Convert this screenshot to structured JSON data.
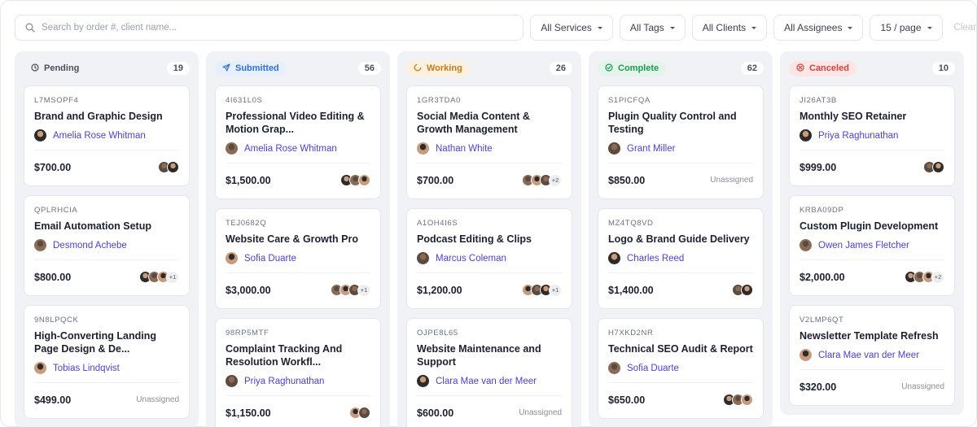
{
  "search": {
    "placeholder": "Search by order #, client name..."
  },
  "filters": [
    {
      "label": "All Services"
    },
    {
      "label": "All Tags"
    },
    {
      "label": "All Clients"
    },
    {
      "label": "All Assignees"
    },
    {
      "label": "15 / page"
    }
  ],
  "clear_label": "Clear",
  "colors": {
    "avatar_a": "#5b4a3f",
    "avatar_b": "#2e2a28",
    "avatar_c": "#8a6b55",
    "avatar_d": "#c79b7d"
  },
  "columns": [
    {
      "status": "Pending",
      "icon": "clock-icon",
      "count": "19",
      "color": "#4a4f5b",
      "bg": "transparent",
      "cards": [
        {
          "code": "L7MSOPF4",
          "title": "Brand and Graphic Design",
          "client": "Amelia Rose Whitman",
          "price": "$700.00",
          "assignees": 2,
          "more": "",
          "unassigned": ""
        },
        {
          "code": "QPLRHCIA",
          "title": "Email Automation Setup",
          "client": "Desmond Achebe",
          "price": "$800.00",
          "assignees": 3,
          "more": "+1",
          "unassigned": ""
        },
        {
          "code": "9N8LPQCK",
          "title": "High-Converting Landing Page Design & De...",
          "client": "Tobias Lindqvist",
          "price": "$499.00",
          "assignees": 0,
          "more": "",
          "unassigned": "Unassigned"
        }
      ]
    },
    {
      "status": "Submitted",
      "icon": "send-icon",
      "count": "56",
      "color": "#2f6fd6",
      "bg": "#e6effc",
      "cards": [
        {
          "code": "4I631L0S",
          "title": "Professional Video Editing & Motion Grap...",
          "client": "Amelia Rose Whitman",
          "price": "$1,500.00",
          "assignees": 3,
          "more": "",
          "unassigned": ""
        },
        {
          "code": "TEJ0682Q",
          "title": "Website Care & Growth Pro",
          "client": "Sofia Duarte",
          "price": "$3,000.00",
          "assignees": 3,
          "more": "+1",
          "unassigned": ""
        },
        {
          "code": "98RP5MTF",
          "title": "Complaint Tracking And Resolution Workfl...",
          "client": "Priya Raghunathan",
          "price": "$1,150.00",
          "assignees": 2,
          "more": "",
          "unassigned": ""
        }
      ]
    },
    {
      "status": "Working",
      "icon": "spinner-icon",
      "count": "26",
      "color": "#c7791a",
      "bg": "#fdf0dc",
      "cards": [
        {
          "code": "1GR3TDA0",
          "title": "Social Media Content & Growth Management",
          "client": "Nathan White",
          "price": "$700.00",
          "assignees": 3,
          "more": "+2",
          "unassigned": ""
        },
        {
          "code": "A1OH4I6S",
          "title": "Podcast Editing & Clips",
          "client": "Marcus Coleman",
          "price": "$1,200.00",
          "assignees": 3,
          "more": "+1",
          "unassigned": ""
        },
        {
          "code": "OJPE8L65",
          "title": "Website Maintenance and Support",
          "client": "Clara Mae van der Meer",
          "price": "$600.00",
          "assignees": 0,
          "more": "",
          "unassigned": "Unassigned"
        }
      ]
    },
    {
      "status": "Complete",
      "icon": "check-circle-icon",
      "count": "62",
      "color": "#1f9a55",
      "bg": "#e3f5ea",
      "cards": [
        {
          "code": "S1PICFQA",
          "title": "Plugin Quality Control and Testing",
          "client": "Grant Miller",
          "price": "$850.00",
          "assignees": 0,
          "more": "",
          "unassigned": "Unassigned"
        },
        {
          "code": "MZ4TQ8VD",
          "title": "Logo & Brand Guide Delivery",
          "client": "Charles Reed",
          "price": "$1,400.00",
          "assignees": 2,
          "more": "",
          "unassigned": ""
        },
        {
          "code": "H7XKD2NR",
          "title": "Technical SEO Audit & Report",
          "client": "Sofia Duarte",
          "price": "$650.00",
          "assignees": 3,
          "more": "",
          "unassigned": ""
        }
      ]
    },
    {
      "status": "Canceled",
      "icon": "cancel-circle-icon",
      "count": "10",
      "color": "#d4423b",
      "bg": "#fce6e5",
      "cards": [
        {
          "code": "JI26AT3B",
          "title": "Monthly SEO Retainer",
          "client": "Priya Raghunathan",
          "price": "$999.00",
          "assignees": 2,
          "more": "",
          "unassigned": ""
        },
        {
          "code": "KRBA09DP",
          "title": "Custom Plugin Development",
          "client": "Owen James Fletcher",
          "price": "$2,000.00",
          "assignees": 3,
          "more": "+2",
          "unassigned": ""
        },
        {
          "code": "V2LMP6QT",
          "title": "Newsletter Template Refresh",
          "client": "Clara Mae van der Meer",
          "price": "$320.00",
          "assignees": 0,
          "more": "",
          "unassigned": "Unassigned"
        }
      ]
    }
  ]
}
